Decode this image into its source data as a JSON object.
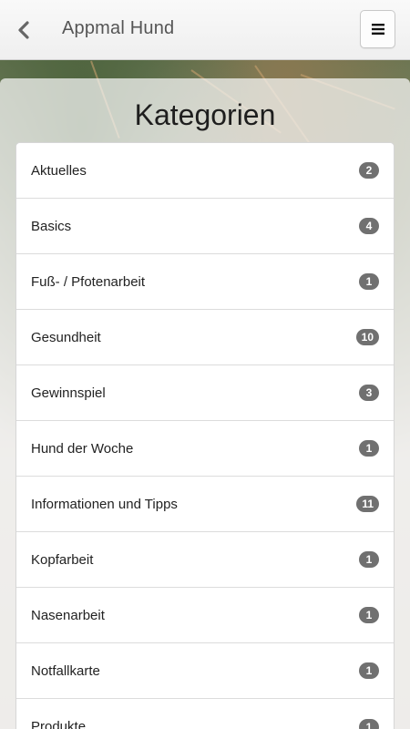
{
  "header": {
    "title": "Appmal Hund",
    "back_icon": "chevron-left-icon",
    "menu_icon": "hamburger-menu-icon"
  },
  "page": {
    "title": "Kategorien"
  },
  "categories": [
    {
      "label": "Aktuelles",
      "count": "2"
    },
    {
      "label": "Basics",
      "count": "4"
    },
    {
      "label": "Fuß- / Pfotenarbeit",
      "count": "1"
    },
    {
      "label": "Gesundheit",
      "count": "10"
    },
    {
      "label": "Gewinnspiel",
      "count": "3"
    },
    {
      "label": "Hund der Woche",
      "count": "1"
    },
    {
      "label": "Informationen und Tipps",
      "count": "11"
    },
    {
      "label": "Kopfarbeit",
      "count": "1"
    },
    {
      "label": "Nasenarbeit",
      "count": "1"
    },
    {
      "label": "Notfallkarte",
      "count": "1"
    },
    {
      "label": "Produkte",
      "count": "1"
    }
  ],
  "colors": {
    "badge": "#707070",
    "header_bg": "#f5f5f5",
    "title_text": "#555555"
  }
}
